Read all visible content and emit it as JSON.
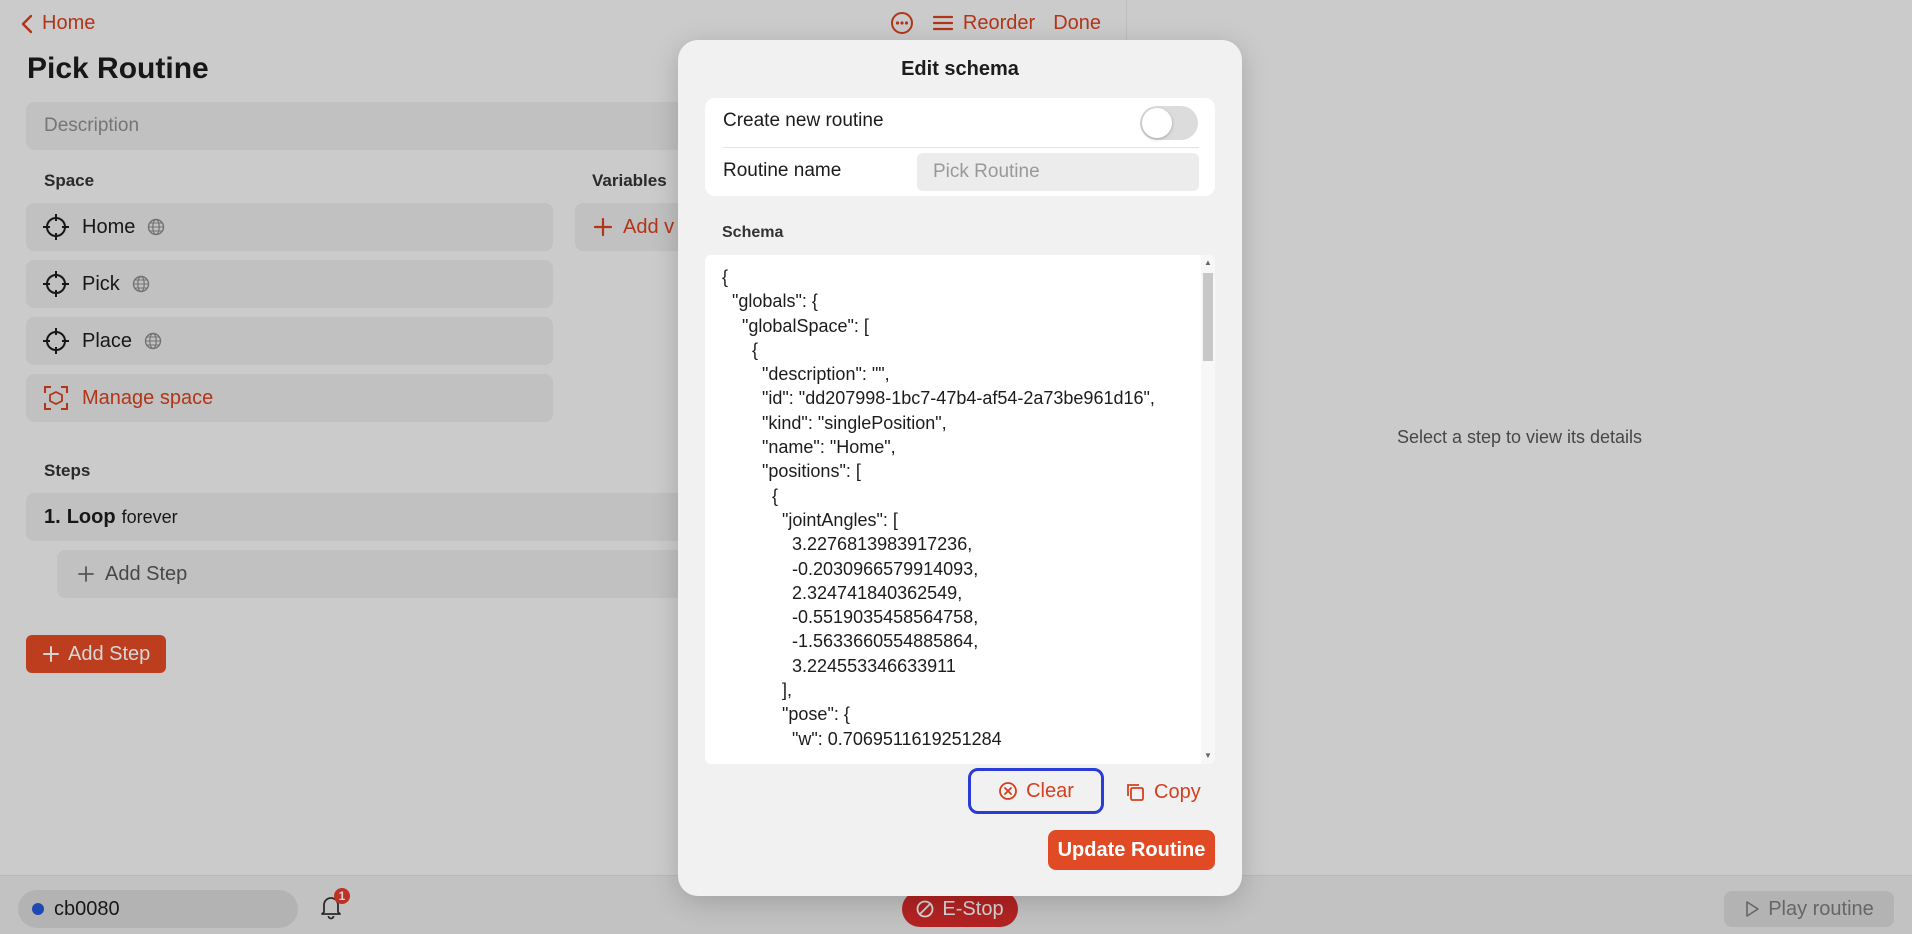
{
  "topbar": {
    "back_label": "Home",
    "reorder_label": "Reorder",
    "done_label": "Done"
  },
  "page": {
    "title": "Pick Routine",
    "description_placeholder": "Description"
  },
  "space": {
    "label": "Space",
    "items": [
      {
        "name": "Home"
      },
      {
        "name": "Pick"
      },
      {
        "name": "Place"
      }
    ],
    "manage_label": "Manage space"
  },
  "variables": {
    "label": "Variables",
    "add_label": "Add v"
  },
  "steps": {
    "label": "Steps",
    "items": [
      {
        "number": "1.",
        "name": "Loop",
        "detail": "forever"
      }
    ],
    "add_step_inner_label": "Add Step",
    "add_step_button_label": "Add Step"
  },
  "right_pane": {
    "placeholder": "Select a step to view its details"
  },
  "bottombar": {
    "robot_name": "cb0080",
    "notification_count": "1",
    "estop_label": "E-Stop",
    "play_label": "Play routine",
    "robot_status_color": "#2457d6"
  },
  "modal": {
    "title": "Edit schema",
    "create_new_label": "Create new routine",
    "create_new_enabled": false,
    "routine_name_label": "Routine name",
    "routine_name_placeholder": "Pick Routine",
    "schema_label": "Schema",
    "schema_text": "{\n  \"globals\": {\n    \"globalSpace\": [\n      {\n        \"description\": \"\",\n        \"id\": \"dd207998-1bc7-47b4-af54-2a73be961d16\",\n        \"kind\": \"singlePosition\",\n        \"name\": \"Home\",\n        \"positions\": [\n          {\n            \"jointAngles\": [\n              3.2276813983917236,\n              -0.2030966579914093,\n              2.324741840362549,\n              -0.5519035458564758,\n              -1.5633660554885864,\n              3.224553346633911\n            ],\n            \"pose\": {\n              \"w\": 0.7069511619251284",
    "clear_label": "Clear",
    "copy_label": "Copy",
    "update_label": "Update Routine"
  },
  "colors": {
    "accent": "#d4401f",
    "accent_button": "#e04a24",
    "estop": "#d62a2a",
    "highlight_outline": "#2b3bd6"
  }
}
